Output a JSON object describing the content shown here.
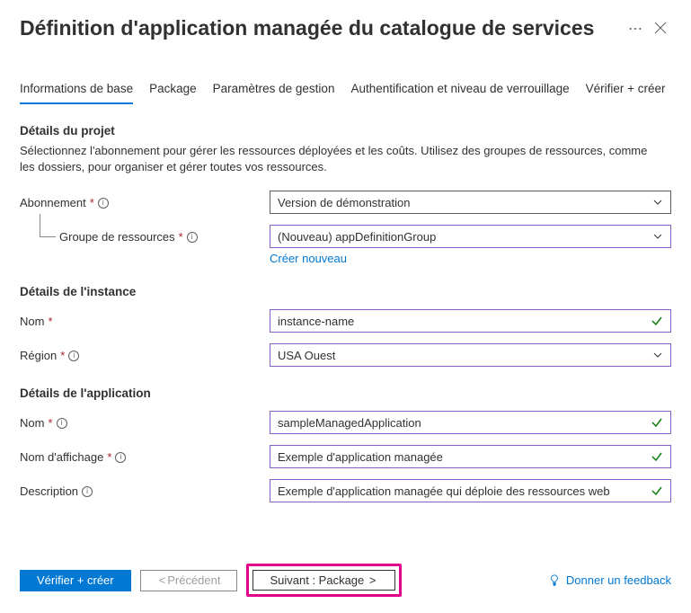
{
  "header": {
    "title": "Définition d'application managée du catalogue de services"
  },
  "tabs": [
    {
      "label": "Informations de base",
      "active": true
    },
    {
      "label": "Package"
    },
    {
      "label": "Paramètres de gestion"
    },
    {
      "label": "Authentification et niveau de verrouillage"
    },
    {
      "label": "Vérifier + créer"
    }
  ],
  "project": {
    "heading": "Détails du projet",
    "desc": "Sélectionnez l'abonnement pour gérer les ressources déployées et les coûts. Utilisez des groupes de ressources, comme les dossiers, pour organiser et gérer toutes vos ressources.",
    "subscription_label": "Abonnement",
    "subscription_value": "Version de démonstration",
    "rg_label": "Groupe de ressources",
    "rg_value": "(Nouveau) appDefinitionGroup",
    "create_new": "Créer nouveau"
  },
  "instance": {
    "heading": "Détails de l'instance",
    "name_label": "Nom",
    "name_value": "instance-name",
    "region_label": "Région",
    "region_value": "USA Ouest"
  },
  "app": {
    "heading": "Détails de l'application",
    "name_label": "Nom",
    "name_value": "sampleManagedApplication",
    "display_label": "Nom d'affichage",
    "display_value": "Exemple d'application managée",
    "desc_label": "Description",
    "desc_value": "Exemple d'application managée qui déploie des ressources web"
  },
  "footer": {
    "review": "Vérifier + créer",
    "prev": "Précédent",
    "next": "Suivant : Package",
    "feedback": "Donner un feedback"
  }
}
